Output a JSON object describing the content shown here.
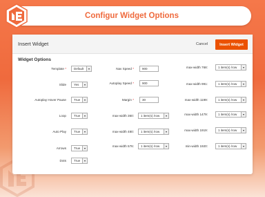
{
  "header": {
    "title": "Configur Widget Options"
  },
  "panel": {
    "title": "Insert Widget",
    "cancel_label": "Cancel",
    "insert_label": "Insert Widget",
    "section_title": "Widget Options"
  },
  "col1": [
    {
      "label": "Template",
      "required": true,
      "type": "select",
      "value": "Default"
    },
    {
      "label": "Slide",
      "required": false,
      "type": "select",
      "value": "Yes"
    },
    {
      "label": "Autoplay Hover Pause",
      "required": false,
      "type": "select",
      "value": "True"
    },
    {
      "label": "Loop",
      "required": false,
      "type": "select",
      "value": "True"
    },
    {
      "label": "Auto Play",
      "required": false,
      "type": "select",
      "value": "True"
    },
    {
      "label": "Arrows",
      "required": false,
      "type": "select",
      "value": "True"
    },
    {
      "label": "Dots",
      "required": false,
      "type": "select",
      "value": "True"
    }
  ],
  "col2": [
    {
      "label": "Nav Speed",
      "required": true,
      "type": "input",
      "value": "900"
    },
    {
      "label": "Autoplay Speed",
      "required": true,
      "type": "input",
      "value": "900"
    },
    {
      "label": "Margin",
      "required": true,
      "type": "input",
      "value": "30"
    },
    {
      "label": "max-width 360:",
      "required": false,
      "type": "select",
      "value": "1 item(s) /row"
    },
    {
      "label": "max-width 480:",
      "required": false,
      "type": "select",
      "value": "1 item(s) /row"
    },
    {
      "label": "max-width 576:",
      "required": false,
      "type": "select",
      "value": "1 item(s) /row"
    }
  ],
  "col3": [
    {
      "label": "max-width 768:",
      "value": "1 item(s) /row"
    },
    {
      "label": "max-width 991:",
      "value": "1 item(s) /row"
    },
    {
      "label": "max-width 1199:",
      "value": "1 item(s) /row"
    },
    {
      "label": "max-width 1479:",
      "value": "1 item(s) /row"
    },
    {
      "label": "max-width 1919:",
      "value": "1 item(s) /row"
    },
    {
      "label": "min-width 1920:",
      "value": "1 item(s) /row"
    }
  ],
  "colors": {
    "accent": "#ef6a3d",
    "button": "#eb5202"
  },
  "icons": {
    "logo": "magento-logo-icon",
    "dropdown": "chevron-down-icon"
  }
}
